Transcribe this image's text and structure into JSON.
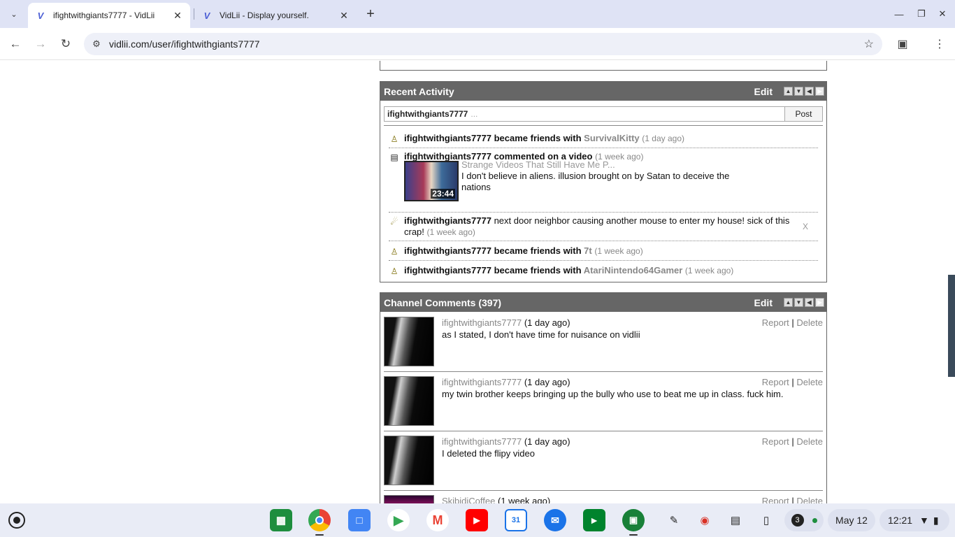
{
  "browser": {
    "tabs": [
      {
        "title": "ifightwithgiants7777 - VidLii",
        "favicon": "V",
        "active": true
      },
      {
        "title": "VidLii - Display yourself.",
        "favicon": "V",
        "active": false
      }
    ],
    "url": "vidlii.com/user/ifightwithgiants7777"
  },
  "activity": {
    "title": "Recent Activity",
    "edit_label": "Edit",
    "status_username": "ifightwithgiants7777",
    "status_placeholder": "...",
    "post_label": "Post",
    "items": [
      {
        "icon": "friend-icon",
        "user": "ifightwithgiants7777",
        "action": " became friends with ",
        "target": "SurvivalKitty",
        "ago": "(1 day ago)"
      },
      {
        "icon": "comment-icon",
        "user": "ifightwithgiants7777",
        "action": " commented on a video",
        "ago": "(1 week ago)",
        "video_title": "Strange Videos That Still Have Me P...",
        "video_duration": "23:44",
        "comment": "I don't believe in aliens. illusion brought on by Satan to deceive the nations"
      },
      {
        "icon": "megaphone-icon",
        "user": "ifightwithgiants7777",
        "message": " next door neighbor causing another mouse to enter my house! sick of this crap!",
        "ago": "(1 week ago)",
        "remove": "X"
      },
      {
        "icon": "friend-icon",
        "user": "ifightwithgiants7777",
        "action": " became friends with ",
        "target": "7t",
        "ago": "(1 week ago)"
      },
      {
        "icon": "friend-icon",
        "user": "ifightwithgiants7777",
        "action": " became friends with ",
        "target": "AtariNintendo64Gamer",
        "ago": "(1 week ago)"
      }
    ]
  },
  "comments": {
    "title": "Channel Comments (397)",
    "edit_label": "Edit",
    "report_label": "Report",
    "delete_label": "Delete",
    "separator": "|",
    "items": [
      {
        "author": "ifightwithgiants7777",
        "ago": "(1 day ago)",
        "body": "as I stated, I don't have time for nuisance on vidlii"
      },
      {
        "author": "ifightwithgiants7777",
        "ago": "(1 day ago)",
        "body": "my twin brother keeps bringing up the bully who use to beat me up in class. fuck him."
      },
      {
        "author": "ifightwithgiants7777",
        "ago": "(1 day ago)",
        "body": "I deleted the flipy video"
      },
      {
        "author": "SkibidiCoffee",
        "ago": "(1 week ago)",
        "body": ""
      }
    ]
  },
  "shelf": {
    "notification_count": "3",
    "date": "May 12",
    "time": "12:21"
  }
}
